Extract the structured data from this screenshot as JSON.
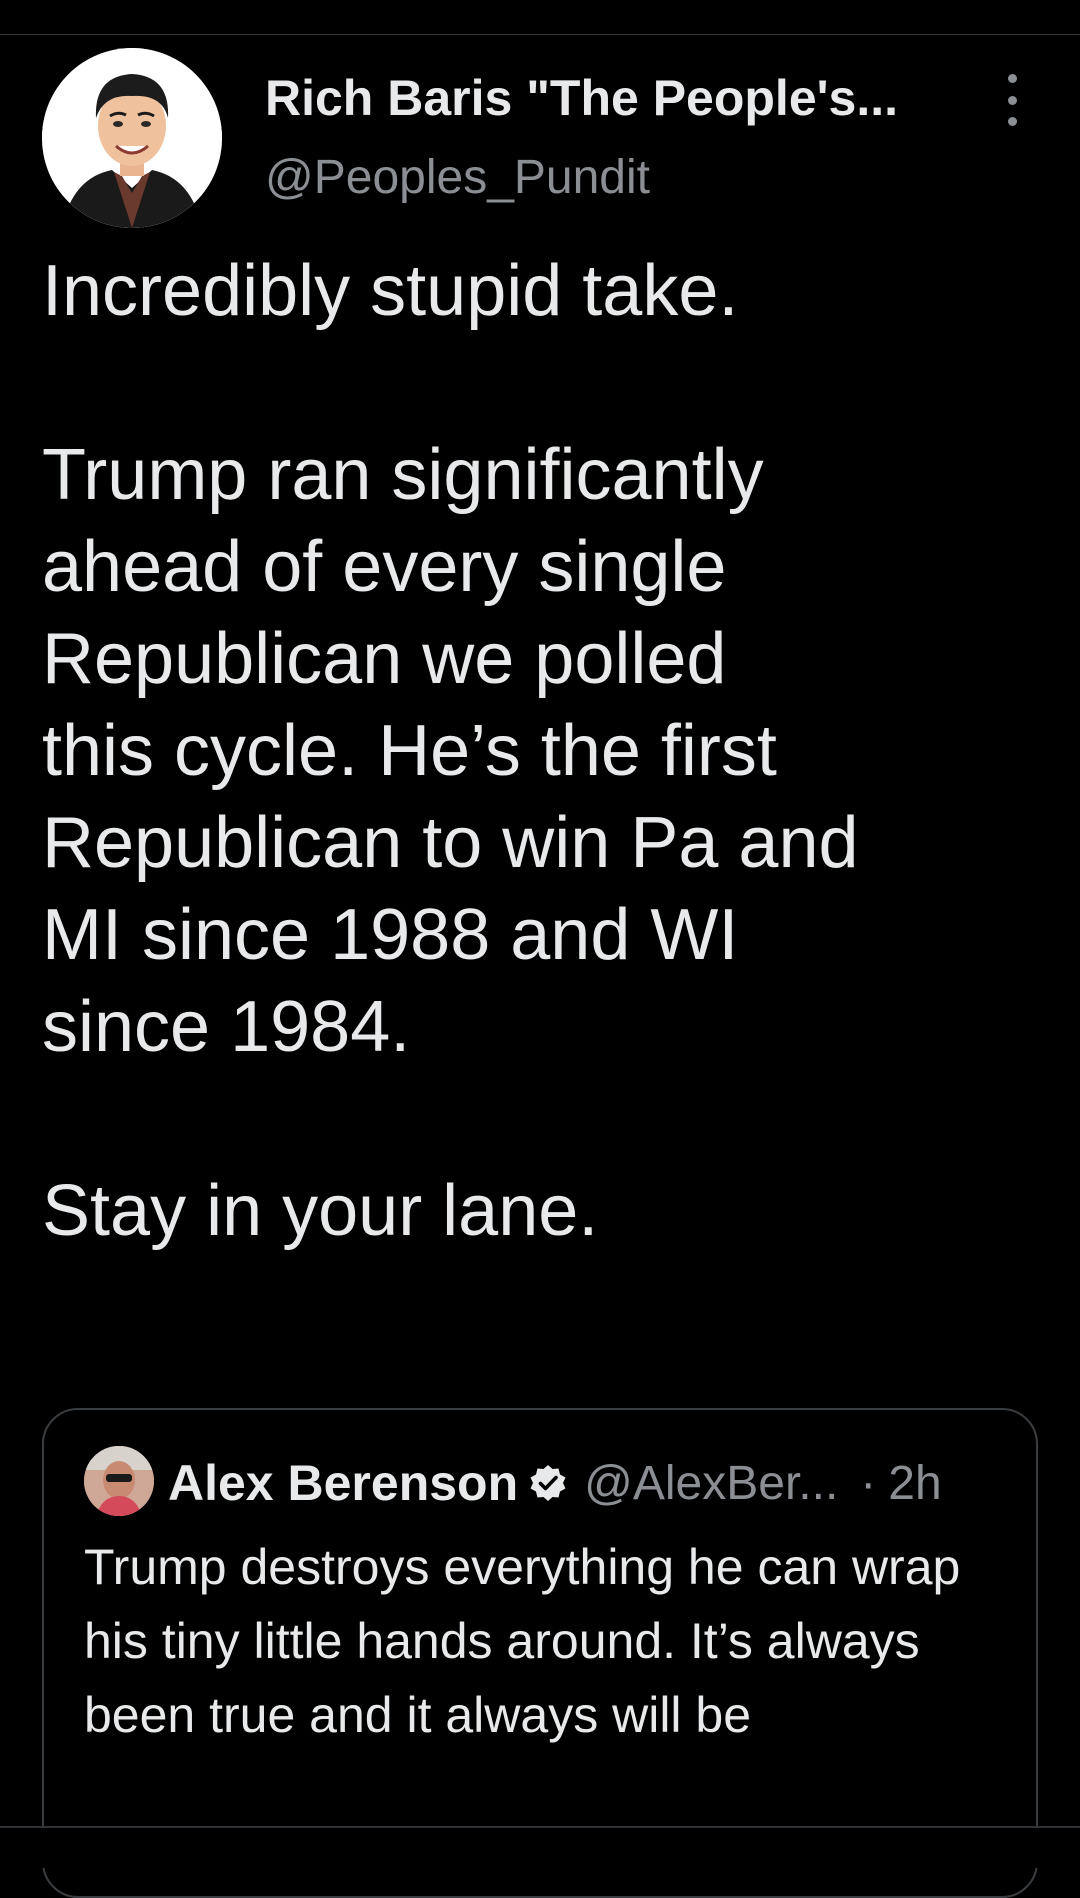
{
  "tweet": {
    "author": {
      "display_name": "Rich Baris \"The People's...",
      "handle": "@Peoples_Pundit"
    },
    "paragraphs": [
      "Incredibly stupid take.",
      "Trump ran significantly\nahead of every single\nRepublican we polled\nthis cycle. He’s the first\nRepublican to win Pa and\nMI since 1988 and WI\nsince 1984.",
      "Stay in your lane."
    ]
  },
  "quoted_tweet": {
    "author": {
      "display_name": "Alex Berenson",
      "handle": "@AlexBer...",
      "verified": true
    },
    "separator": "·",
    "time": "2h",
    "text": "Trump destroys everything he can wrap his tiny little hands around. It’s always been true and it always will be"
  },
  "icons": {
    "more": "more-vertical-icon",
    "verified": "verified-badge-icon"
  },
  "colors": {
    "background": "#000000",
    "text": "#e7e9ea",
    "secondary_text": "#8b8f94",
    "border": "#3a3d40"
  }
}
